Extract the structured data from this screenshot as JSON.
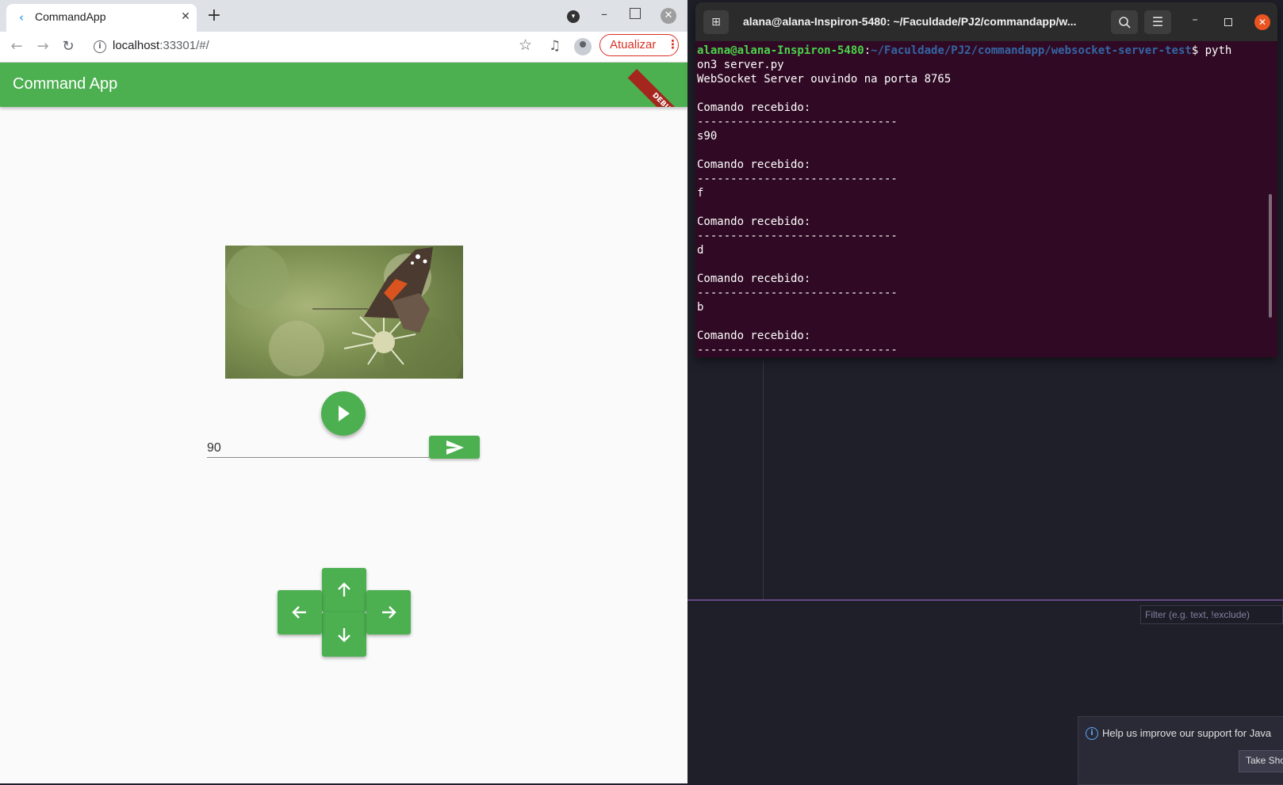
{
  "browser": {
    "tab": {
      "title": "CommandApp",
      "close": "✕"
    },
    "new_tab": "+",
    "window_controls": {
      "dropdown": "▾",
      "minimize": "–",
      "close": "✕"
    },
    "toolbar": {
      "back": "←",
      "forward": "→",
      "reload": "↻",
      "info": "i",
      "url_host": "localhost",
      "url_rest": ":33301/#/",
      "star": "☆",
      "media": "♫",
      "update_label": "Atualizar",
      "update_dots": "⋮"
    }
  },
  "app": {
    "title": "Command App",
    "debug_banner": "DEBUG",
    "input_value": "90",
    "accent": "#4caf50"
  },
  "terminal": {
    "title": "alana@alana-Inspiron-5480: ~/Faculdade/PJ2/commandapp/w...",
    "new_tab": "⊞",
    "menu": "☰",
    "minimize": "–",
    "close": "✕",
    "prompt_user": "alana@alana-Inspiron-5480",
    "prompt_sep": ":",
    "prompt_path": "~/Faculdade/PJ2/commandapp/websocket-server-test",
    "prompt_cmd": "$ pyth",
    "lines": [
      "on3 server.py",
      "WebSocket Server ouvindo na porta 8765",
      "",
      "Comando recebido:",
      "------------------------------",
      "s90",
      "",
      "Comando recebido:",
      "------------------------------",
      "f",
      "",
      "Comando recebido:",
      "------------------------------",
      "d",
      "",
      "Comando recebido:",
      "------------------------------",
      "b",
      "",
      "Comando recebido:",
      "------------------------------"
    ]
  },
  "ide": {
    "filter_placeholder": "Filter (e.g. text, !exclude)",
    "notification": {
      "icon": "i",
      "text": "Help us improve our support for Java",
      "button": "Take Sho"
    }
  }
}
